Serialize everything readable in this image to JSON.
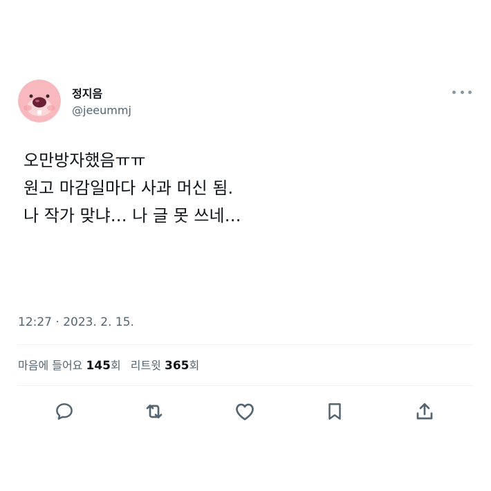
{
  "tweet": {
    "author": {
      "display_name": "정지음",
      "handle": "@jeeummj",
      "avatar_icon": "pink-beaver-avatar"
    },
    "lines": [
      "오만방자했음ㅠㅠ",
      "원고 마감일마다 사과 머신 됨.",
      "나 작가 맞냐… 나 글 못 쓰네…"
    ],
    "timestamp": "12:27 · 2023. 2. 15.",
    "stats": {
      "likes_label": "마음에 들어요",
      "likes_count": "145",
      "likes_suffix": "회",
      "retweets_label": "리트윗",
      "retweets_count": "365",
      "retweets_suffix": "회"
    }
  },
  "actions": [
    {
      "icon": "reply-icon"
    },
    {
      "icon": "retweet-icon"
    },
    {
      "icon": "heart-icon"
    },
    {
      "icon": "bookmark-icon"
    },
    {
      "icon": "share-icon"
    }
  ],
  "colors": {
    "text": "#0f1419",
    "secondary": "#536471",
    "icon": "#536471",
    "divider": "#eff3f4"
  }
}
